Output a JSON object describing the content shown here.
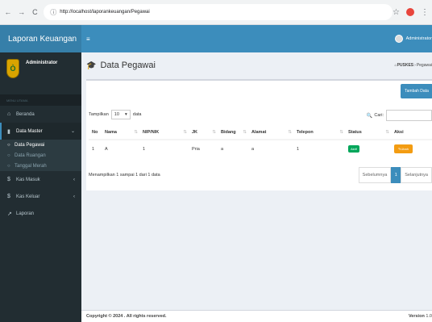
{
  "browser": {
    "url": "http://localhost/laporankeuangan/Pegawai"
  },
  "sidebar": {
    "brand": "Laporan Keuangan",
    "user_name": "Administrator",
    "menu_header": "MENU UTAMA",
    "items": [
      {
        "label": "Beranda",
        "icon": "home-icon"
      },
      {
        "label": "Data Master",
        "icon": "book-icon"
      },
      {
        "label": "Kas Masuk",
        "icon": "dollar-icon"
      },
      {
        "label": "Kas Keluar",
        "icon": "dollar-icon"
      },
      {
        "label": "Laporan",
        "icon": "chart-icon"
      }
    ],
    "submenu": [
      {
        "label": "Data Pegawai"
      },
      {
        "label": "Data Ruangan"
      },
      {
        "label": "Tanggal Merah"
      }
    ]
  },
  "navbar": {
    "user": "Administrator"
  },
  "page": {
    "title": "Data Pegawai",
    "breadcrumb_home": "PUSKES",
    "breadcrumb_sep": "›",
    "breadcrumb_current": "Pegawai"
  },
  "table_ctrl": {
    "tambah": "Tambah Data",
    "show_prefix": "Tampilkan",
    "show_value": "10",
    "show_suffix": "data",
    "search_label": "Cari:"
  },
  "table": {
    "headers": [
      "No",
      "Nama",
      "NIP/NIK",
      "JK",
      "Bidang",
      "Alamat",
      "Telepon",
      "Status",
      "Aksi"
    ],
    "rows": [
      {
        "no": "1",
        "nama": "A",
        "nip": "1",
        "jk": "Pria",
        "bidang": "a",
        "alamat": "a",
        "telepon": "1",
        "status": "Aktif",
        "aksi": "Ubah"
      }
    ]
  },
  "pagination": {
    "info": "Menampilkan 1 sampai 1 dari 1 data",
    "prev": "Sebelumnya",
    "current": "1",
    "next": "Selanjutnya"
  },
  "footer": {
    "copyright": "Copyright © 2024 . All rights reserved.",
    "version_label": "Version",
    "version": "1.0"
  }
}
